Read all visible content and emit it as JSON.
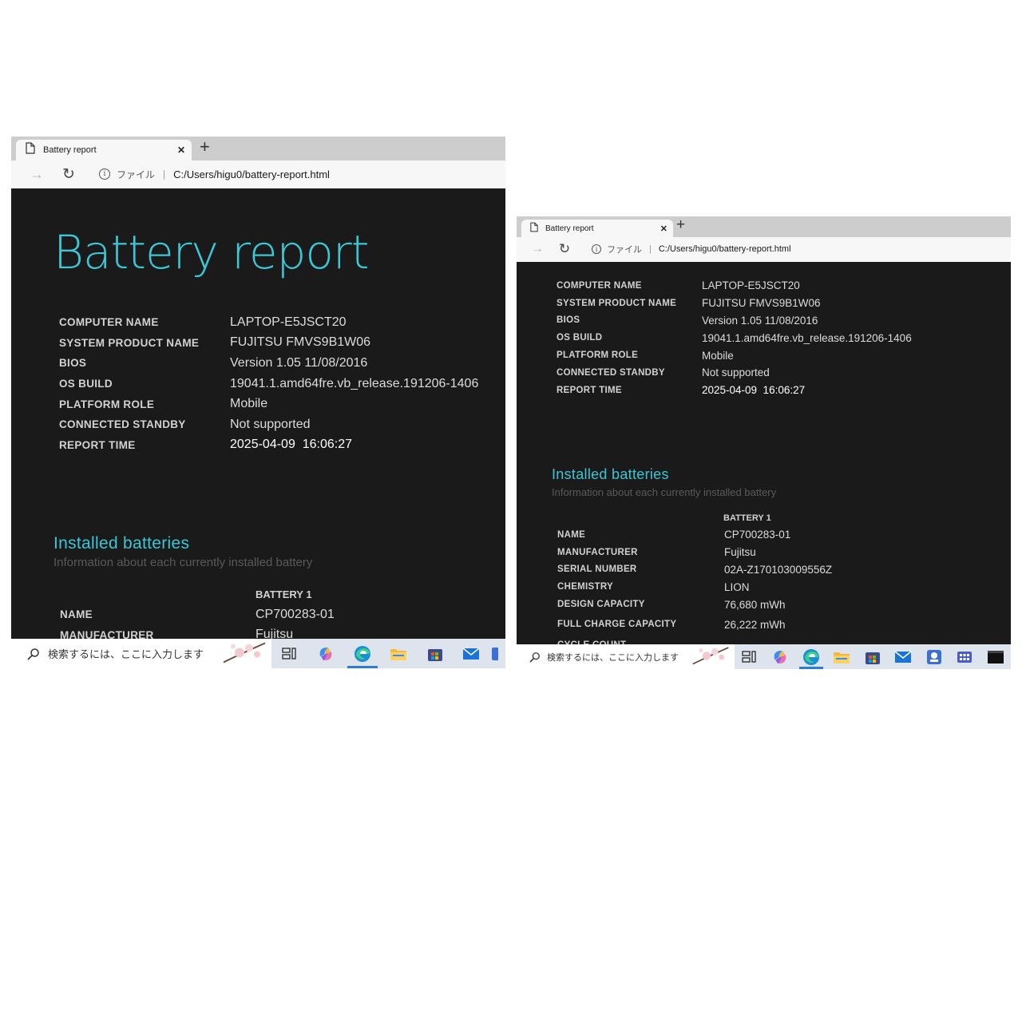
{
  "browser": {
    "tab_title": "Battery report",
    "close_glyph": "✕",
    "newtab_glyph": "+",
    "back_glyph": "←",
    "forward_glyph": "→",
    "refresh_glyph": "↻",
    "file_label": "ファイル",
    "separator": "|",
    "url": "C:/Users/higu0/battery-report.html"
  },
  "report": {
    "title": "Battery report",
    "info": [
      {
        "key": "COMPUTER NAME",
        "value": "LAPTOP-E5JSCT20"
      },
      {
        "key": "SYSTEM PRODUCT NAME",
        "value": "FUJITSU FMVS9B1W06"
      },
      {
        "key": "BIOS",
        "value": "Version 1.05 11/08/2016"
      },
      {
        "key": "OS BUILD",
        "value": "19041.1.amd64fre.vb_release.191206-1406"
      },
      {
        "key": "PLATFORM ROLE",
        "value": "Mobile"
      },
      {
        "key": "CONNECTED STANDBY",
        "value": "Not supported"
      },
      {
        "key": "REPORT TIME",
        "value": "2025-04-09  16:06:27"
      }
    ],
    "installed": {
      "title": "Installed batteries",
      "subtitle": "Information about each currently installed battery",
      "column": "BATTERY 1",
      "rows": [
        {
          "key": "NAME",
          "value": "CP700283-01"
        },
        {
          "key": "MANUFACTURER",
          "value": "Fujitsu"
        },
        {
          "key": "SERIAL NUMBER",
          "value": "02A-Z170103009556Z"
        },
        {
          "key": "CHEMISTRY",
          "value": "LION"
        },
        {
          "key": "DESIGN CAPACITY",
          "value": "76,680 mWh"
        },
        {
          "key": "FULL CHARGE CAPACITY",
          "value": "26,222 mWh"
        },
        {
          "key": "CYCLE COUNT",
          "value": ""
        }
      ]
    }
  },
  "taskbar": {
    "search_placeholder": "検索するには、ここに入力します",
    "left_icons": [
      "task-view-icon",
      "copilot-icon",
      "edge-icon",
      "file-explorer-icon",
      "microsoft-store-icon",
      "mail-icon",
      "partial-app-icon"
    ],
    "right_icons": [
      "task-view-icon",
      "copilot-icon",
      "edge-icon",
      "file-explorer-icon",
      "microsoft-store-icon",
      "mail-icon",
      "app-icon-blue",
      "app-icon-grid",
      "terminal-icon"
    ],
    "active_icon": "edge-icon"
  },
  "colors": {
    "accent": "#3cc6d6",
    "report_bg": "#1a1a1a",
    "tabbar_bg": "#cdcdcd",
    "taskbar_bg": "#dde4ee"
  }
}
